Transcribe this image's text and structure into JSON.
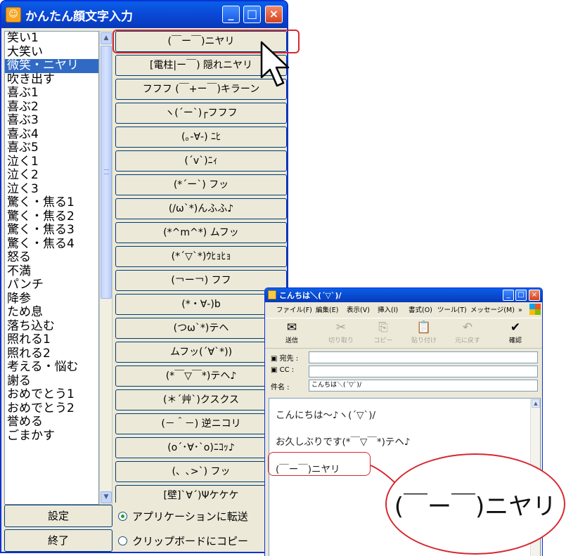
{
  "main_window": {
    "title": "かんたん顔文字入力",
    "app_icon_glyph": "☺",
    "controls": {
      "minimize": "_",
      "maximize": "□",
      "close": "×"
    },
    "list_items": [
      "笑い1",
      "大笑い",
      "微笑・ニヤリ",
      "吹き出す",
      "喜ぶ1",
      "喜ぶ2",
      "喜ぶ3",
      "喜ぶ4",
      "喜ぶ5",
      "泣く1",
      "泣く2",
      "泣く3",
      "驚く・焦る1",
      "驚く・焦る2",
      "驚く・焦る3",
      "驚く・焦る4",
      "怒る",
      "不満",
      "パンチ",
      "降参",
      "ため息",
      "落ち込む",
      "照れる1",
      "照れる2",
      "考える・悩む",
      "謝る",
      "おめでとう1",
      "おめでとう2",
      "誉める",
      "ごまかす"
    ],
    "selected_index": 2,
    "scroll_up": "▲",
    "scroll_down": "▼",
    "kaomoji_buttons": [
      "(￣ー￣)ニヤリ",
      "[電柱|ー￣) 隠れニヤリ",
      "フフフ (￣+ー￣)キラーン",
      "ヽ(´ー`)┌フフフ",
      "(｡-∀-) ﾆﾋ",
      "(´v`)ﾆｨ",
      "(*´ー`) フッ",
      "(/ω`*)んふふ♪",
      "(*^m^*) ムフッ",
      "(*´▽`*)ｳﾋｮﾋｮ",
      "(￢ー￢) フフ",
      "(*・∀-)b",
      "(つω`*)テヘ",
      "ムフッ(´∀`*))",
      "(*￣▽￣*)テヘ♪",
      "(＊´艸`)クスクス",
      "(－＾－) 逆ニコリ",
      "(o´･∀･`o)ﾆｺｯ♪",
      "(、､>`) フッ",
      "[壁]`∀´)Ψケケケ"
    ],
    "settings_label": "設定",
    "exit_label": "終了",
    "radio_app": "アプリケーションに転送",
    "radio_clip": "クリップボードにコピー",
    "radio_selected": "app"
  },
  "mail_window": {
    "title": "こんちは＼(´▽`)/",
    "controls": {
      "minimize": "_",
      "maximize": "□",
      "close": "×"
    },
    "menus": [
      "ファイル(F)",
      "編集(E)",
      "表示(V)",
      "挿入(I)",
      "書式(O)",
      "ツール(T)",
      "メッセージ(M)"
    ],
    "menu_more": "»",
    "toolbar": [
      {
        "label": "送信",
        "icon": "✉",
        "enabled": true
      },
      {
        "label": "切り取り",
        "icon": "✂",
        "enabled": false
      },
      {
        "label": "コピー",
        "icon": "⎘",
        "enabled": false
      },
      {
        "label": "貼り付け",
        "icon": "📋",
        "enabled": false
      },
      {
        "label": "元に戻す",
        "icon": "↶",
        "enabled": false
      },
      {
        "label": "確認",
        "icon": "✔",
        "enabled": true
      }
    ],
    "to_label": "宛先 :",
    "cc_label": "CC :",
    "subject_label": "件名 :",
    "to_value": "",
    "cc_value": "",
    "subject_value": "こんちは＼(´▽`)/",
    "body_lines": [
      "こんにちは～♪ヽ(´▽`)/",
      "お久しぶりです(*￣▽￣*)テヘ♪",
      "(￣ー￣)ニヤリ"
    ],
    "scroll_up": "▲"
  },
  "zoom_text": "(￣ー￣)ニヤリ",
  "colors": {
    "highlight_red": "#d7282f",
    "title_blue": "#0a4fdd",
    "selection_blue": "#316ac5"
  }
}
